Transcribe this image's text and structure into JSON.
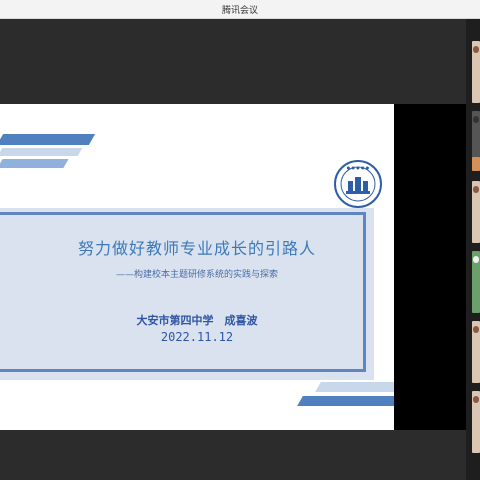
{
  "window": {
    "title": "腾讯会议"
  },
  "slide": {
    "title": "努力做好教师专业成长的引路人",
    "subtitle": "——构建校本主题研修系统的实践与探索",
    "author": "大安市第四中学　成喜波",
    "date": "2022.11.12"
  },
  "colors": {
    "accent_blue": "#5f86bf",
    "title_blue": "#3d79b8",
    "author_blue": "#2f55a4",
    "background": "#2c2c2c"
  },
  "participants": {
    "thumbnails": [
      {
        "icon": "participant-video"
      },
      {
        "icon": "participant-video"
      },
      {
        "icon": "participant-video"
      },
      {
        "icon": "participant-video"
      },
      {
        "icon": "participant-video"
      },
      {
        "icon": "participant-video"
      },
      {
        "icon": "participant-video"
      },
      {
        "icon": "participant-video"
      }
    ]
  }
}
